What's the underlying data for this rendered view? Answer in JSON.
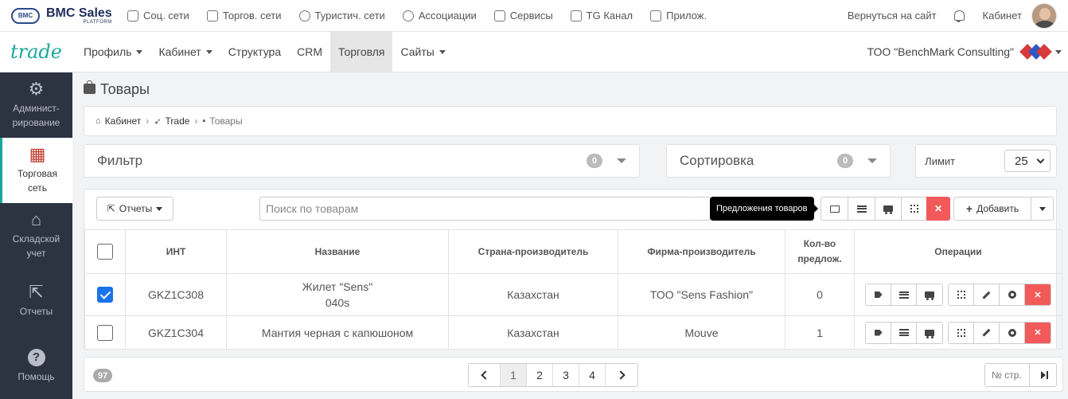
{
  "topbar": {
    "brand_name": "BMC Sales",
    "brand_sub": "PLATFORM",
    "brand_logo_text": "BMC",
    "links": [
      {
        "label": "Соц. сети",
        "icon": "chat-icon"
      },
      {
        "label": "Торгов. сети",
        "icon": "cart-icon"
      },
      {
        "label": "Туристич. сети",
        "icon": "globe-icon"
      },
      {
        "label": "Ассоциации",
        "icon": "globe-icon"
      },
      {
        "label": "Сервисы",
        "icon": "inbox-icon"
      },
      {
        "label": "TG Канал",
        "icon": "send-icon"
      },
      {
        "label": "Прилож.",
        "icon": "phone-icon"
      }
    ],
    "back_label": "Вернуться на сайт",
    "cabinet_label": "Кабинет"
  },
  "navbar": {
    "logo": "trade",
    "items": [
      "Профиль",
      "Кабинет",
      "Структура",
      "CRM",
      "Торговля",
      "Сайты"
    ],
    "org": "ТОО \"BenchMark Consulting\""
  },
  "sidebar": [
    {
      "label_1": "Админист-",
      "label_2": "рирование",
      "icon": "gears-icon"
    },
    {
      "label_1": "Торговая",
      "label_2": "сеть",
      "icon": "store-icon"
    },
    {
      "label_1": "Складской",
      "label_2": "учет",
      "icon": "warehouse-icon"
    },
    {
      "label_1": "Отчеты",
      "label_2": "",
      "icon": "share-icon"
    },
    {
      "label_1": "Помощь",
      "label_2": "",
      "icon": "question-icon"
    }
  ],
  "page": {
    "title": "Товары",
    "breadcrumb": [
      "Кабинет",
      "Trade",
      "Товары"
    ]
  },
  "filter": {
    "label": "Фильтр",
    "count": "0"
  },
  "sort": {
    "label": "Сортировка",
    "count": "0"
  },
  "limit": {
    "label": "Лимит",
    "value": "25"
  },
  "toolbar": {
    "reports_label": "Отчеты",
    "search_placeholder": "Поиск по товарам",
    "tooltip": "Предложения товаров",
    "add_label": "Добавить"
  },
  "table": {
    "columns": [
      "ИНТ",
      "Название",
      "Страна-производитель",
      "Фирма-производитель",
      "Кол-во",
      "предлож.",
      "Операции"
    ],
    "rows": [
      {
        "checked": true,
        "int": "GKZ1C308",
        "name_1": "Жилет \"Sens\"",
        "name_2": "040s",
        "country": "Казахстан",
        "firm": "ТОО \"Sens Fashion\"",
        "offers": "0"
      },
      {
        "checked": false,
        "int": "GKZ1C304",
        "name_1": "Мантия черная с капюшоном",
        "name_2": "",
        "country": "Казахстан",
        "firm": "Mouve",
        "offers": "1"
      }
    ]
  },
  "pager": {
    "total": "97",
    "pages": [
      "1",
      "2",
      "3",
      "4"
    ],
    "current": "1",
    "page_input_placeholder": "№ стр."
  },
  "colors": {
    "accent": "#1aa89a",
    "sidebar": "#2c3442",
    "danger": "#f25a5a",
    "checkbox": "#1a73e8"
  }
}
